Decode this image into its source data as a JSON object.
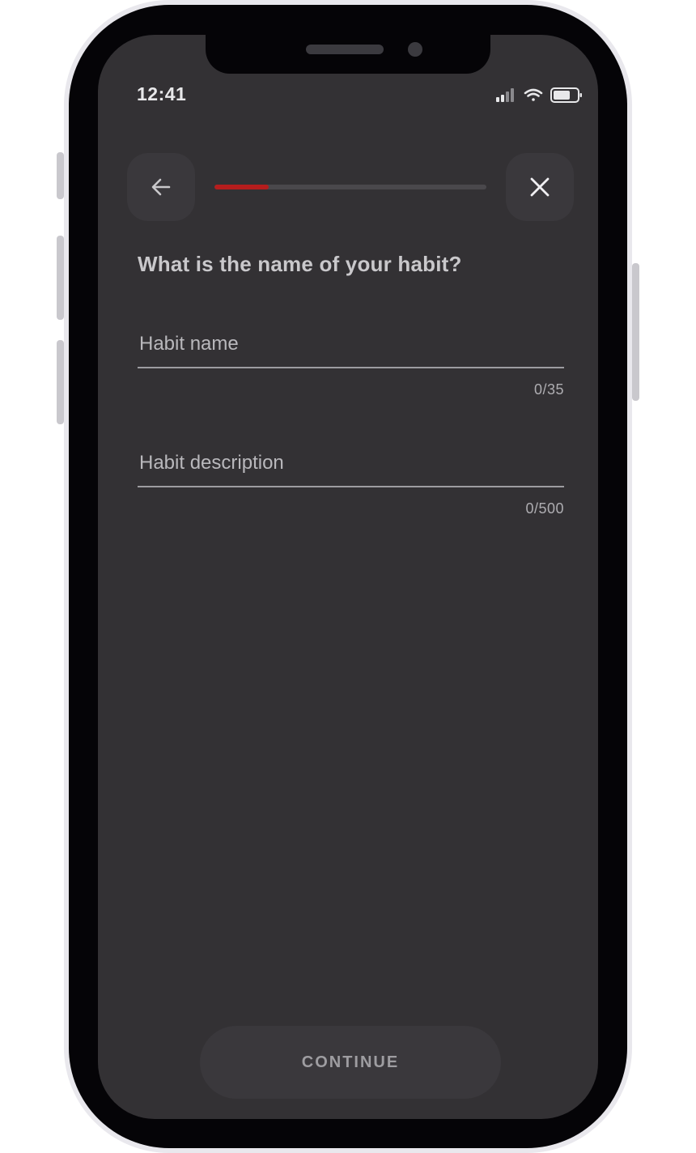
{
  "status_bar": {
    "time": "12:41",
    "icons": [
      "cellular-signal-icon",
      "wifi-icon",
      "battery-icon"
    ]
  },
  "header": {
    "back_icon": "arrow-left-icon",
    "close_icon": "close-icon",
    "progress": 0.2,
    "progress_color": "#b51d1d"
  },
  "question": "What is the name of your habit?",
  "habit_name": {
    "placeholder": "Habit name",
    "value": "",
    "counter": "0/35"
  },
  "habit_description": {
    "placeholder": "Habit description",
    "value": "",
    "counter": "0/500"
  },
  "continue_label": "CONTINUE",
  "colors": {
    "screen_background": "#333134",
    "button_background": "#3a383c",
    "accent": "#b51d1d"
  }
}
